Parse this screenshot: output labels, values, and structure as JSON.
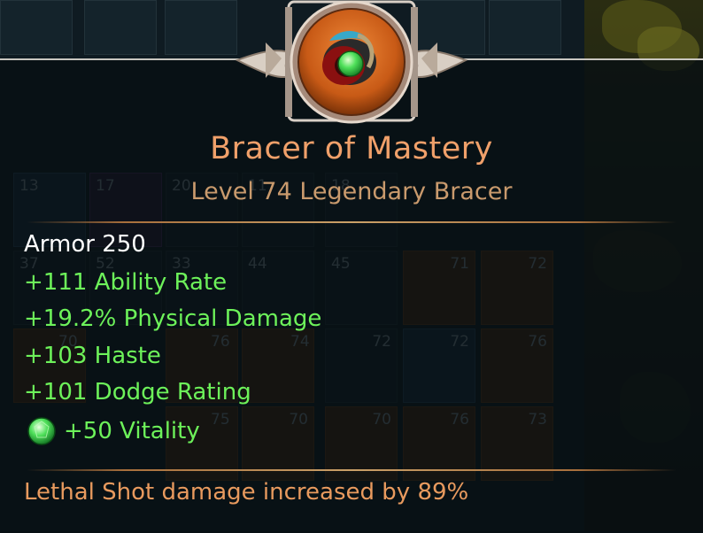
{
  "inventory": {
    "row1": [
      {
        "num": "13"
      },
      {
        "num": "17"
      },
      {
        "num": "20"
      },
      {
        "num": "11"
      },
      {
        "num": "18"
      }
    ],
    "row2": [
      {
        "num": "37"
      },
      {
        "num": "52"
      },
      {
        "num": "33"
      },
      {
        "num": "44"
      },
      {
        "num": "45"
      },
      {
        "num": "71"
      },
      {
        "num": "72"
      }
    ],
    "row3": [
      {
        "num": "70"
      },
      {
        "num": "76"
      },
      {
        "num": "74"
      },
      {
        "num": "72"
      },
      {
        "num": "72"
      },
      {
        "num": "76"
      }
    ],
    "row4": [
      {
        "num": "75"
      },
      {
        "num": "70"
      },
      {
        "num": "70"
      },
      {
        "num": "76"
      },
      {
        "num": "73"
      }
    ]
  },
  "item": {
    "name": "Bracer of Mastery",
    "subtitle": "Level 74 Legendary Bracer",
    "armor": "Armor 250",
    "stats": [
      "+111 Ability Rate",
      "+19.2% Physical Damage",
      "+103 Haste",
      "+101 Dodge Rating"
    ],
    "gem_stat": "+50 Vitality",
    "effect": "Lethal Shot damage increased by 89%"
  },
  "colors": {
    "title": "#f0a06a",
    "subtitle": "#c99a6d",
    "stat_green": "#6df25a",
    "armor_white": "#ffffff",
    "effect_orange": "#e89a5e",
    "gem": "#3dd64a"
  },
  "icons": {
    "item_icon": "bracer-icon",
    "gem_icon": "emerald-gem-icon"
  }
}
